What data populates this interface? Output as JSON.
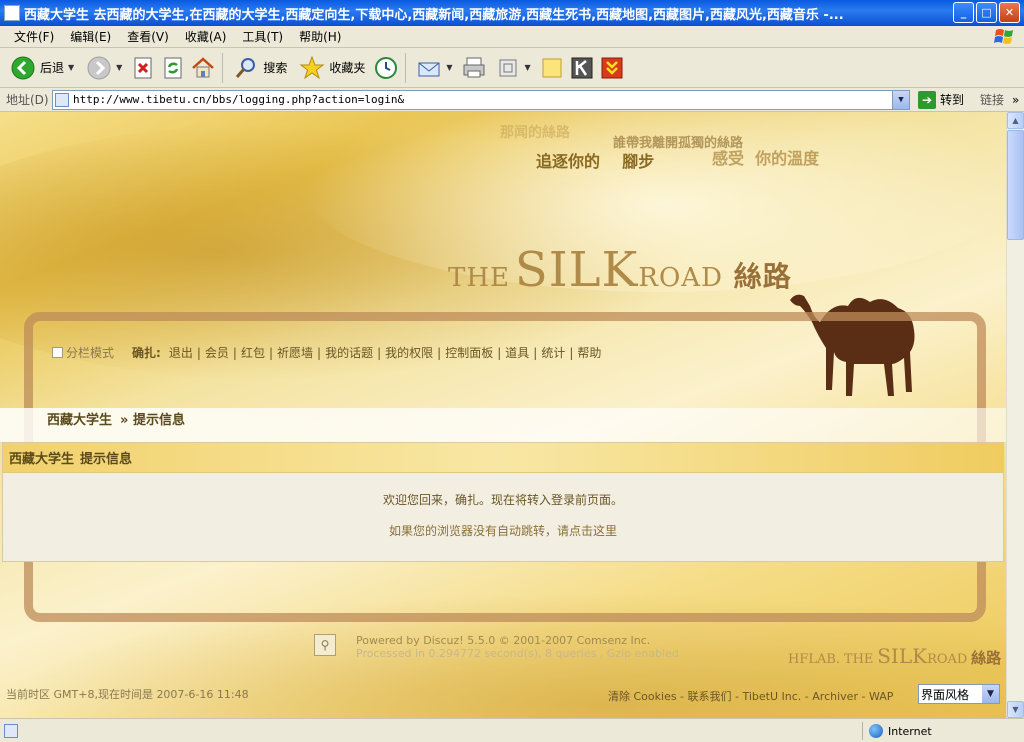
{
  "window": {
    "title": "西藏大学生 去西藏的大学生,在西藏的大学生,西藏定向生,下载中心,西藏新闻,西藏旅游,西藏生死书,西藏地图,西藏图片,西藏风光,西藏音乐 -...",
    "buttons": {
      "minimize": "_",
      "maximize": "□",
      "close": "✕"
    }
  },
  "menubar": [
    "文件(F)",
    "编辑(E)",
    "查看(V)",
    "收藏(A)",
    "工具(T)",
    "帮助(H)"
  ],
  "toolbar": {
    "back": "后退",
    "search": "搜索",
    "favorites": "收藏夹"
  },
  "address": {
    "label": "地址(D)",
    "url": "http://www.tibetu.cn/bbs/logging.php?action=login&",
    "go": "转到",
    "links": "链接",
    "more": "»"
  },
  "banner": {
    "slogan_faded": "那闻的絲路",
    "slogan_right_top": "誰帶我離開孤獨的絲路",
    "slogan_main_1": "追逐你的",
    "slogan_main_2": "腳步",
    "slogan_right_1": "感受",
    "slogan_right_2": "你的溫度",
    "brand_the": "THE",
    "brand_silk": "SILK",
    "brand_road": "ROAD",
    "brand_cn": "絲路"
  },
  "nav": {
    "split_mode": "分栏模式",
    "user": "确扎:",
    "links": [
      "退出",
      "会员",
      "红包",
      "祈愿墙",
      "我的话题",
      "我的权限",
      "控制面板",
      "道具",
      "统计",
      "帮助"
    ]
  },
  "breadcrumb": {
    "forum": "西藏大学生",
    "page": "» 提示信息"
  },
  "message": {
    "header_forum": "西藏大学生",
    "header_title": "提示信息",
    "welcome": "欢迎您回来，确扎。现在将转入登录前页面。",
    "redirect_link": "如果您的浏览器没有自动跳转，请点击这里"
  },
  "footer": {
    "powered": "Powered by Discuz! 5.5.0 © 2001-2007 Comsenz Inc.",
    "processed": "Processed in 0.294772 second(s), 8 queries , Gzip enabled",
    "hflab_1": "HFLAB.",
    "hflab_2": "THE",
    "hflab_3": "SILK",
    "hflab_4": "ROAD",
    "hflab_5": "絲路",
    "time": "当前时区 GMT+8,现在时间是 2007-6-16 11:48",
    "links": [
      "清除 Cookies",
      "联系我们",
      "TibetU Inc.",
      "Archiver",
      "WAP"
    ],
    "style_select": "界面风格"
  },
  "status": {
    "zone": "Internet"
  }
}
